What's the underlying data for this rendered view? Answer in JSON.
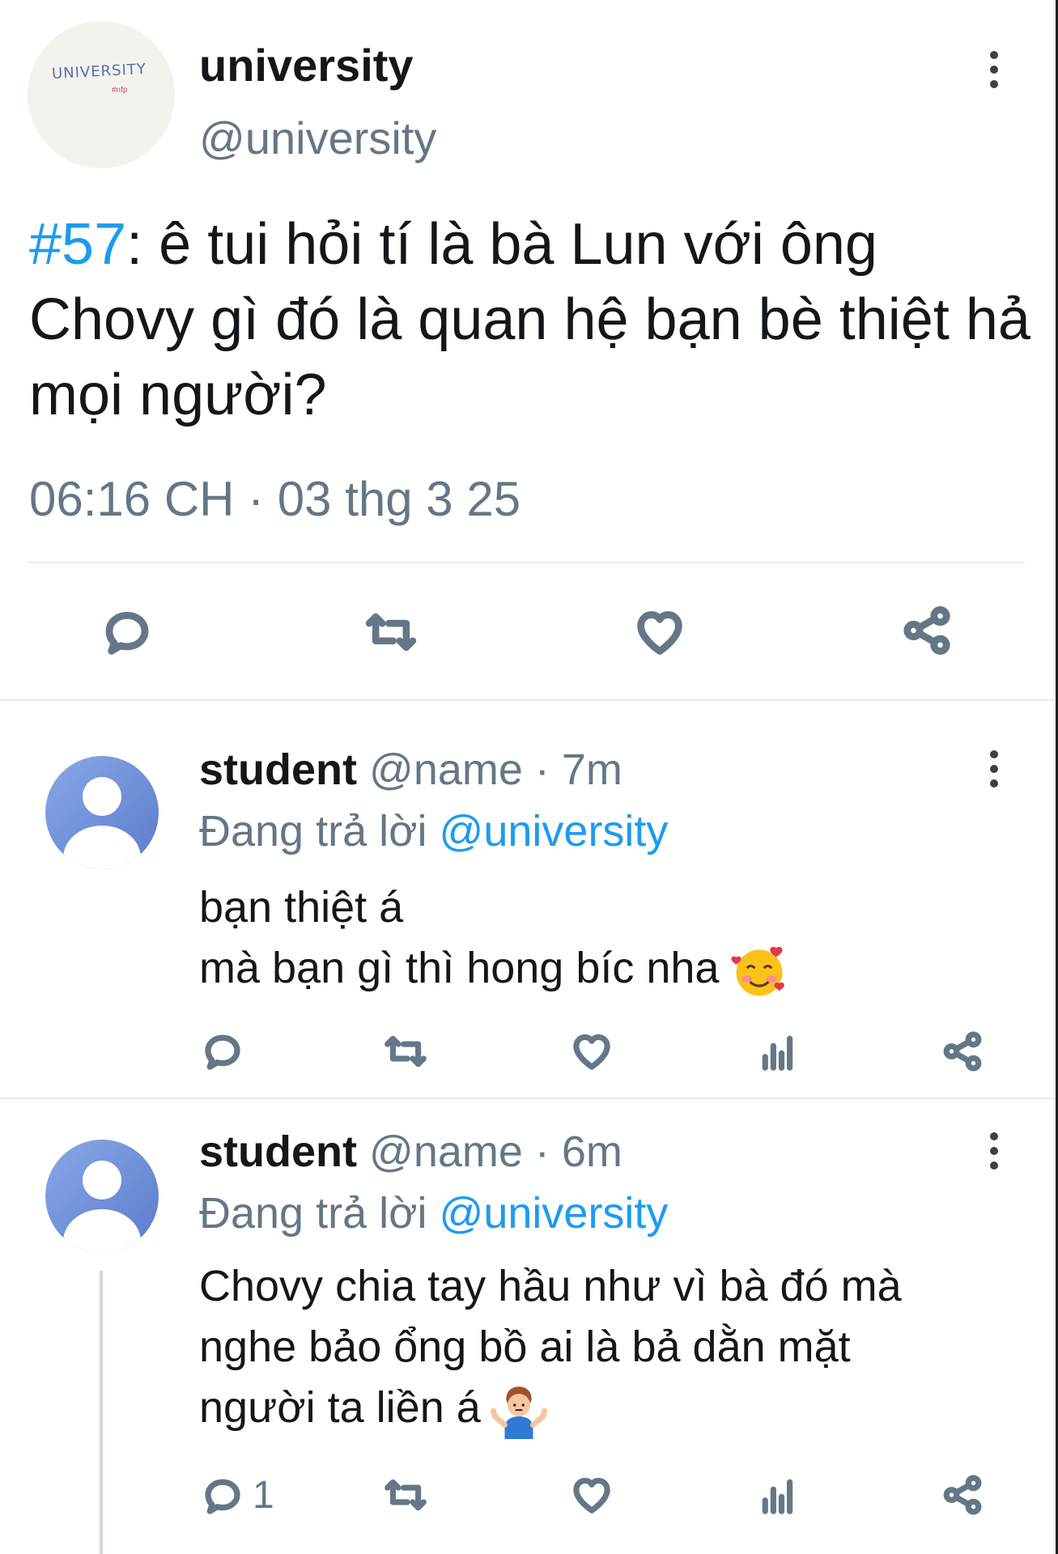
{
  "main_tweet": {
    "author_name": "university",
    "author_handle": "@university",
    "avatar_logo_text": "UNIVERSITY",
    "avatar_logo_sub": "#nfp",
    "hashtag": "#57",
    "text": ": ê tui hỏi tí là bà Lun với ông Chovy gì đó là quan hệ bạn bè thiệt hả mọi người?",
    "timestamp": "06:16 CH · 03 thg 3 25",
    "actions": [
      "reply-icon",
      "retweet-icon",
      "like-icon",
      "share-icon"
    ]
  },
  "replies": [
    {
      "author_name": "student",
      "meta": " @name · 7m",
      "replying_prefix": "Đang trả lời ",
      "replying_to": "@university",
      "line1": "bạn thiệt á",
      "line2": "mà bạn gì thì hong bíc nha",
      "emoji": "smiling-face-with-hearts",
      "reply_count": ""
    },
    {
      "author_name": "student",
      "meta": " @name · 6m",
      "replying_prefix": "Đang trả lời ",
      "replying_to": "@university",
      "line1": "Chovy chia tay hầu như vì bà đó mà",
      "line2": "nghe bảo ổng bồ ai là bả dằn mặt",
      "line3": "người ta liền á",
      "emoji": "person-shrugging",
      "reply_count": "1"
    }
  ],
  "colors": {
    "accent": "#1d9bf0",
    "muted": "#657786",
    "divider": "#e6ecf0",
    "avatar": "#6f8fd8"
  }
}
